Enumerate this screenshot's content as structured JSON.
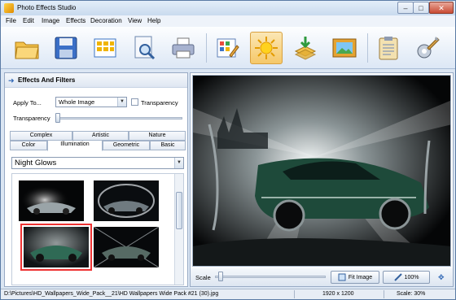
{
  "window": {
    "title": "Photo Effects Studio"
  },
  "menu": [
    "File",
    "Edit",
    "Image",
    "Effects",
    "Decoration",
    "View",
    "Help"
  ],
  "toolbar": {
    "buttons": [
      {
        "icon": "open-folder-icon"
      },
      {
        "icon": "save-disk-icon"
      },
      {
        "icon": "grid-icon"
      },
      {
        "icon": "preview-search-icon"
      },
      {
        "icon": "printer-icon"
      },
      {
        "icon": "edit-grid-icon"
      },
      {
        "icon": "sun-effects-icon",
        "active": true
      },
      {
        "icon": "layers-download-icon"
      },
      {
        "icon": "picture-frame-icon"
      },
      {
        "icon": "clipboard-icon"
      },
      {
        "icon": "settings-tools-icon"
      }
    ]
  },
  "effects_panel": {
    "title": "Effects And Filters",
    "apply_to_label": "Apply To...",
    "apply_to_value": "Whole Image",
    "transparency_checkbox_label": "Transparency",
    "transparency_label": "Transparency",
    "transparency_value": 0,
    "tabs_row1": [
      "Complex",
      "Artistic",
      "Nature"
    ],
    "tabs_row2": [
      "Color",
      "Illumination",
      "Geometric",
      "Basic"
    ],
    "selected_tab": "Illumination",
    "effect_preset": "Night Glows",
    "selected_thumbnail_index": 2
  },
  "preview": {
    "scale_label": "Scale",
    "fit_image_label": "Fit Image",
    "zoom_button_label": "100%"
  },
  "status": {
    "path": "D:\\Pictures\\HD_Wallpapers_Wide_Pack__21\\HD Wallpapers Wide Pack #21 (30).jpg",
    "dimensions": "1920 x 1200",
    "scale": "Scale: 30%"
  },
  "colors": {
    "accent": "#2f66b5",
    "selection_outline": "#ee3333",
    "active_tool": "#f5c869"
  }
}
